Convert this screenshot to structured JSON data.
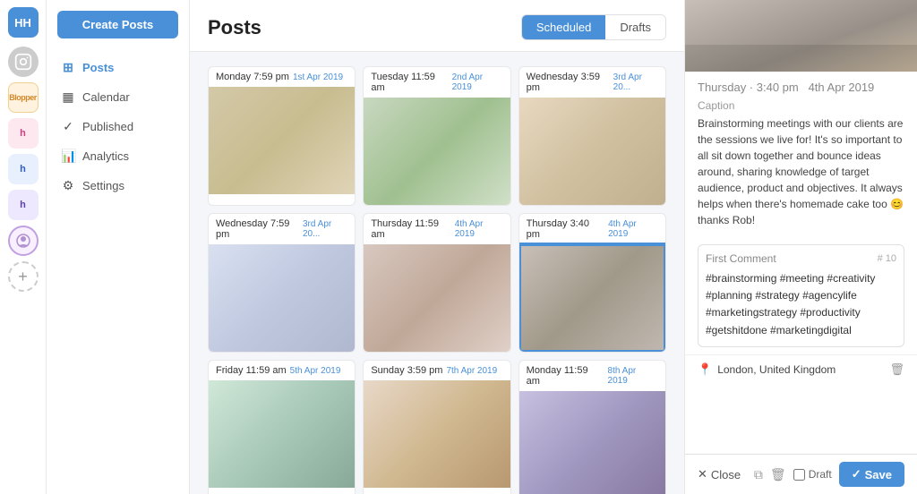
{
  "app": {
    "logo": "HH",
    "logo_bg": "#4a90d9"
  },
  "sidebar": {
    "create_btn": "Create Posts",
    "nav_items": [
      {
        "id": "posts",
        "label": "Posts",
        "icon": "⊞",
        "active": true
      },
      {
        "id": "calendar",
        "label": "Calendar",
        "icon": "📅",
        "active": false
      },
      {
        "id": "published",
        "label": "Published",
        "icon": "✓",
        "active": false
      },
      {
        "id": "analytics",
        "label": "Analytics",
        "icon": "📊",
        "active": false
      },
      {
        "id": "settings",
        "label": "Settings",
        "icon": "⚙",
        "active": false
      }
    ]
  },
  "main": {
    "title": "Posts",
    "tabs": [
      {
        "id": "scheduled",
        "label": "Scheduled",
        "active": true
      },
      {
        "id": "drafts",
        "label": "Drafts",
        "active": false
      }
    ],
    "posts": [
      {
        "day": "Monday",
        "time": "7:59 pm",
        "date": "1st Apr 2019",
        "img_class": "img-desk"
      },
      {
        "day": "Tuesday",
        "time": "11:59 am",
        "date": "2nd Apr 2019",
        "img_class": "img-plant"
      },
      {
        "day": "Wednesday",
        "time": "3:59 pm",
        "date": "3rd Apr 20...",
        "img_class": "img-whiteboard"
      },
      {
        "day": "Wednesday",
        "time": "7:59 pm",
        "date": "3rd Apr 20...",
        "img_class": "img-office"
      },
      {
        "day": "Thursday",
        "time": "11:59 am",
        "date": "4th Apr 2019",
        "img_class": "img-meeting"
      },
      {
        "day": "Thursday",
        "time": "3:40 pm",
        "date": "4th Apr 2019",
        "img_class": "img-meeting2"
      },
      {
        "day": "Friday",
        "time": "11:59 am",
        "date": "5th Apr 2019",
        "img_class": "img-person"
      },
      {
        "day": "Sunday",
        "time": "3:59 pm",
        "date": "7th Apr 2019",
        "img_class": "img-crowd"
      },
      {
        "day": "Monday",
        "time": "11:59 am",
        "date": "8th Apr 2019",
        "img_class": "img-punch"
      }
    ]
  },
  "right_panel": {
    "datetime_label": "Thursday · 3:40 pm",
    "datetime_date": "4th Apr 2019",
    "caption_label": "Caption",
    "caption_text": "Brainstorming meetings with our clients are the sessions we live for! It's so important to all sit down together and bounce ideas around, sharing knowledge of target audience, product and objectives. It always helps when there's homemade cake too 😊  thanks Rob!",
    "comment_label": "First Comment",
    "comment_count": "# 10",
    "comment_text": "#brainstorming #meeting #creativity\n#planning #strategy #agencylife\n#marketingstrategy #productivity\n#getshitdone #marketingdigital",
    "location": "London, United Kingdom",
    "footer": {
      "close_label": "Close",
      "draft_label": "Draft",
      "save_label": "Save"
    }
  },
  "icons": {
    "posts": "⊞",
    "calendar": "📅",
    "published": "✓",
    "analytics": "📊",
    "settings": "⚙",
    "location_pin": "📍",
    "close_x": "✕",
    "check": "✓",
    "copy": "⧉",
    "trash": "🗑",
    "save_check": "✓"
  }
}
